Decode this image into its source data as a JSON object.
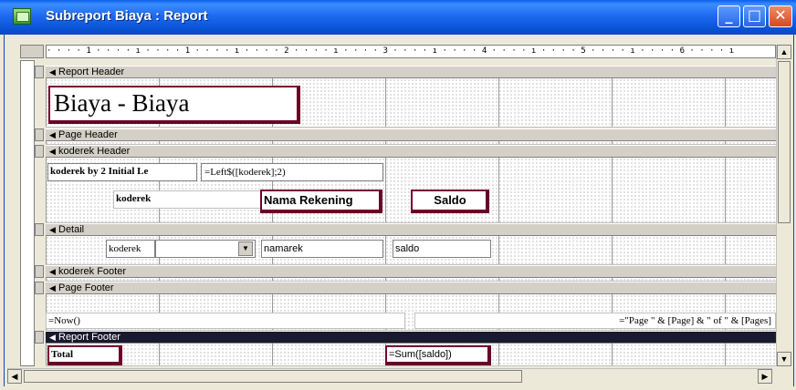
{
  "window": {
    "title": "Subreport Biaya : Report",
    "minimize_label": "_",
    "maximize_label": "□",
    "close_label": "✕"
  },
  "ruler": {
    "text": "· · · · 1 · · · · ı · · · · 1 · · · · ı · · · · 2 · · · · ı · · · · 3 · · · · ı · · · · 4 · · · · ı · · · · 5 · · · · ı · · · · 6 · · · · ı"
  },
  "sections": {
    "report_header": "Report Header",
    "page_header": "Page Header",
    "koderek_header": "koderek Header",
    "detail": "Detail",
    "koderek_footer": "koderek Footer",
    "page_footer": "Page Footer",
    "report_footer": "Report Footer"
  },
  "controls": {
    "report_title": "Biaya - Biaya",
    "group_label": "koderek by 2 Initial Le",
    "group_expr": "=Left$([koderek];2)",
    "col_koderek": "koderek",
    "col_nama": "Nama Rekening",
    "col_saldo": "Saldo",
    "detail_koderek": "koderek",
    "detail_namarek": "namarek",
    "detail_saldo": "saldo",
    "now_expr": "=Now()",
    "page_expr": "=\"Page \" & [Page] & \" of \" & [Pages]",
    "total_label": "Total",
    "sum_expr": "=Sum([saldo])"
  },
  "icons": {
    "section_arrow": "◀",
    "dropdown": "▼",
    "scroll_left": "◀",
    "scroll_right": "▶",
    "scroll_up": "▲",
    "scroll_down": "▼"
  },
  "colors": {
    "title_bar": "#0a54d8",
    "selection": "#7a0030"
  }
}
